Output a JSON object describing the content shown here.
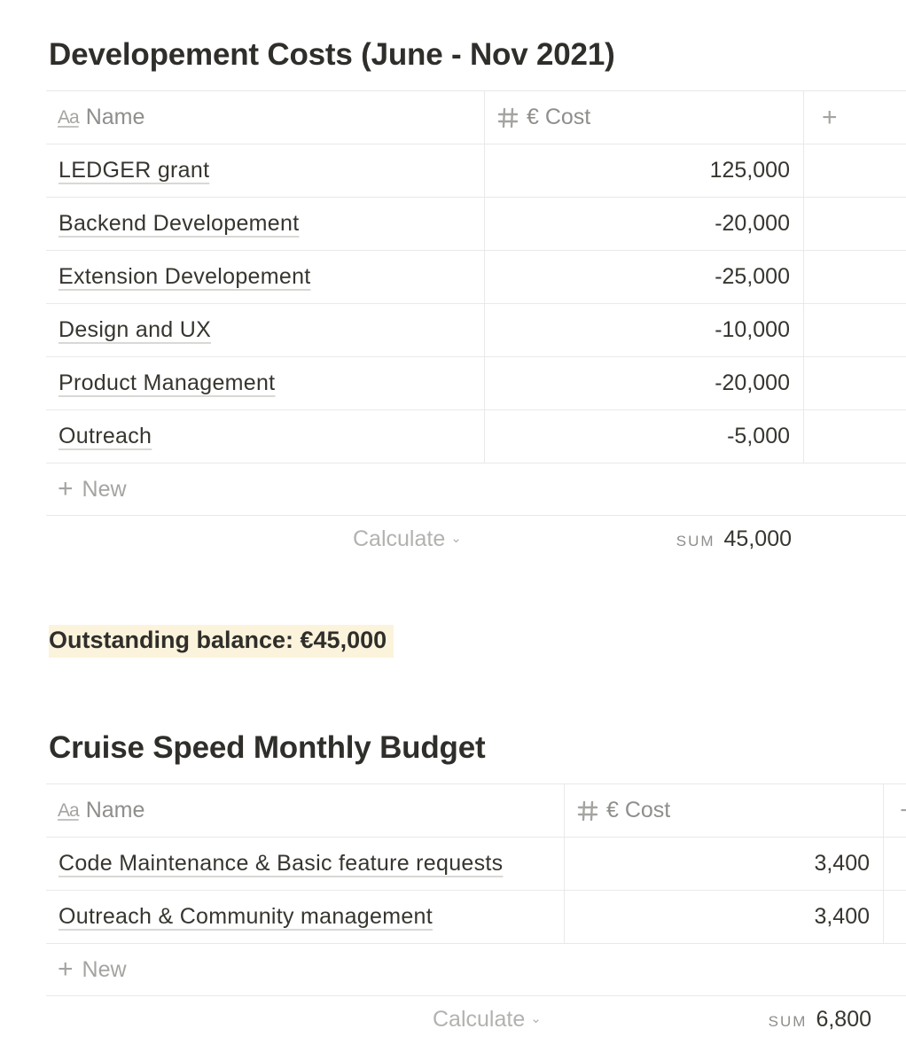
{
  "sections": [
    {
      "title": "Developement Costs (June - Nov 2021)",
      "columns": {
        "name_label": "Name",
        "cost_label": "€ Cost",
        "add_column": "+"
      },
      "rows": [
        {
          "name": "LEDGER grant",
          "cost": "125,000"
        },
        {
          "name": "Backend Developement",
          "cost": "-20,000"
        },
        {
          "name": "Extension Developement",
          "cost": "-25,000"
        },
        {
          "name": "Design and UX",
          "cost": "-10,000"
        },
        {
          "name": "Product Management",
          "cost": "-20,000"
        },
        {
          "name": "Outreach",
          "cost": "-5,000"
        }
      ],
      "new_label": "New",
      "calculate_label": "Calculate",
      "sum_label": "SUM",
      "sum_value": "45,000"
    },
    {
      "title": "Cruise Speed Monthly Budget",
      "columns": {
        "name_label": "Name",
        "cost_label": "€ Cost",
        "add_column": "+"
      },
      "rows": [
        {
          "name": "Code Maintenance & Basic feature requests",
          "cost": "3,400"
        },
        {
          "name": "Outreach & Community management",
          "cost": "3,400"
        }
      ],
      "new_label": "New",
      "calculate_label": "Calculate",
      "sum_label": "SUM",
      "sum_value": "6,800"
    }
  ],
  "callout": {
    "text": "Outstanding balance: €45,000",
    "highlight_color": "#fbf3db"
  },
  "icons": {
    "name_column": "text-property-icon",
    "cost_column": "number-property-icon",
    "new_row": "plus-icon",
    "calculate": "chevron-down-icon"
  },
  "colors": {
    "text": "#37352f",
    "muted": "#8f8e8b",
    "border": "#e9e9e7"
  }
}
